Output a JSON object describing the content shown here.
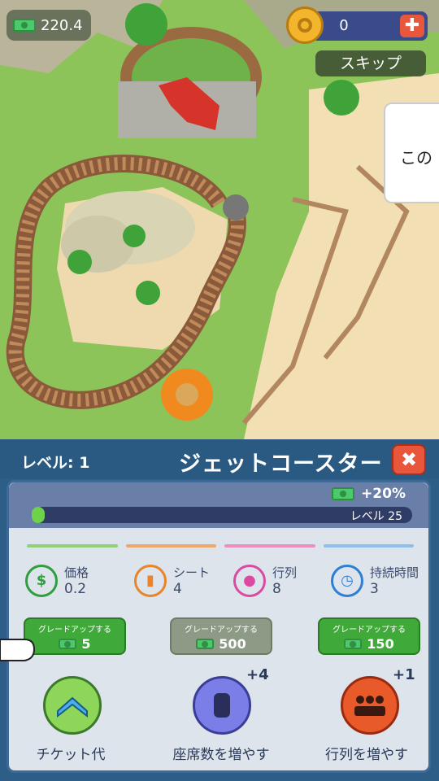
{
  "hud": {
    "cash": "220.4",
    "coins": "0",
    "skip_label": "スキップ",
    "dialog_text": "この"
  },
  "panel": {
    "level_label": "レベル: 1",
    "title": "ジェットコースター",
    "bonus": "+20%",
    "level_bar_label": "レベル 25",
    "level_progress": 0.03,
    "stats": [
      {
        "name": "価格",
        "value": "0.2",
        "icon": "dollar-icon",
        "color": "#2e9e3e"
      },
      {
        "name": "シート",
        "value": "4",
        "icon": "seat-icon",
        "color": "#e8842a"
      },
      {
        "name": "行列",
        "value": "8",
        "icon": "queue-icon",
        "color": "#d94aa0"
      },
      {
        "name": "持続時間",
        "value": "3",
        "icon": "stopwatch-icon",
        "color": "#2e7ed6"
      }
    ],
    "upgrade_caption": "グレードアップする",
    "upgrades": [
      {
        "cost": "5"
      },
      {
        "cost": "500"
      },
      {
        "cost": "150"
      }
    ],
    "actions": [
      {
        "label": "チケット代",
        "plus": ""
      },
      {
        "label": "座席数を増やす",
        "plus": "+4"
      },
      {
        "label": "行列を増やす",
        "plus": "+1"
      }
    ]
  }
}
